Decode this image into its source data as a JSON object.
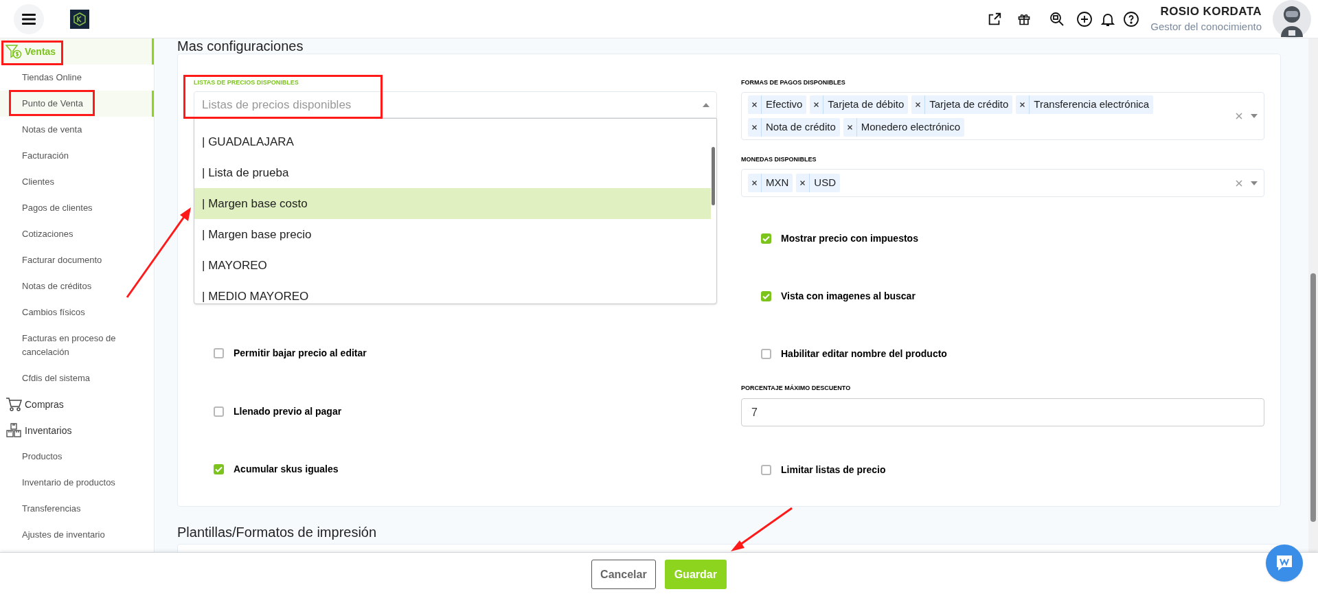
{
  "header": {
    "user_name": "ROSIO KORDATA",
    "user_role": "Gestor del conocimiento"
  },
  "sidebar": {
    "sections": [
      {
        "label": "Ventas",
        "selected": true,
        "children": [
          {
            "label": "Tiendas Online",
            "selected": false
          },
          {
            "label": "Punto de Venta",
            "selected": true
          },
          {
            "label": "Notas de venta",
            "selected": false
          },
          {
            "label": "Facturación",
            "selected": false
          },
          {
            "label": "Clientes",
            "selected": false
          },
          {
            "label": "Pagos de clientes",
            "selected": false
          },
          {
            "label": "Cotizaciones",
            "selected": false
          },
          {
            "label": "Facturar documento",
            "selected": false
          },
          {
            "label": "Notas de créditos",
            "selected": false
          },
          {
            "label": "Cambios físicos",
            "selected": false
          },
          {
            "label": "Facturas en proceso de cancelación",
            "selected": false
          },
          {
            "label": "Cfdis del sistema",
            "selected": false
          }
        ]
      },
      {
        "label": "Compras",
        "selected": false
      },
      {
        "label": "Inventarios",
        "selected": false,
        "children": [
          {
            "label": "Productos",
            "selected": false
          },
          {
            "label": "Inventario de productos",
            "selected": false
          },
          {
            "label": "Transferencias",
            "selected": false
          },
          {
            "label": "Ajustes de inventario",
            "selected": false
          }
        ]
      }
    ]
  },
  "section_title": "Mas configuraciones",
  "price_lists": {
    "label": "LISTAS DE PRECIOS DISPONIBLES",
    "placeholder": "Listas de precios disponibles",
    "expanded": true,
    "options": [
      {
        "label": "| GUADALAJARA",
        "selected": false
      },
      {
        "label": "| Lista de prueba",
        "selected": false
      },
      {
        "label": "| Margen base costo",
        "selected": true
      },
      {
        "label": "| Margen base precio",
        "selected": false
      },
      {
        "label": "| MAYOREO",
        "selected": false
      },
      {
        "label": "| MEDIO MAYOREO",
        "selected": false
      }
    ]
  },
  "payment_methods": {
    "label": "FORMAS DE PAGOS DISPONIBLES",
    "tags": [
      "Efectivo",
      "Tarjeta de débito",
      "Tarjeta de crédito",
      "Transferencia electrónica",
      "Nota de crédito",
      "Monedero electrónico"
    ]
  },
  "currencies": {
    "label": "MONEDAS DISPONIBLES",
    "tags": [
      "MXN",
      "USD"
    ]
  },
  "left_options": [
    {
      "label": "Permitir bajar precio al editar",
      "checked": false
    },
    {
      "label": "Llenado previo al pagar",
      "checked": false
    },
    {
      "label": "Acumular skus iguales",
      "checked": true
    }
  ],
  "right_options": [
    {
      "kind": "checkbox",
      "label": "Mostrar precio con impuestos",
      "checked": true
    },
    {
      "kind": "checkbox",
      "label": "Vista con imagenes al buscar",
      "checked": true
    },
    {
      "kind": "checkbox",
      "label": "Habilitar editar nombre del producto",
      "checked": false
    },
    {
      "kind": "field",
      "label": "PORCENTAJE MÁXIMO DESCUENTO",
      "value": "7"
    },
    {
      "kind": "checkbox",
      "label": "Limitar listas de precio",
      "checked": false
    }
  ],
  "next_section_title": "Plantillas/Formatos de impresión",
  "footer": {
    "buttons": [
      {
        "label": "Cancelar",
        "kind": "secondary"
      },
      {
        "label": "Guardar",
        "kind": "primary"
      }
    ]
  }
}
